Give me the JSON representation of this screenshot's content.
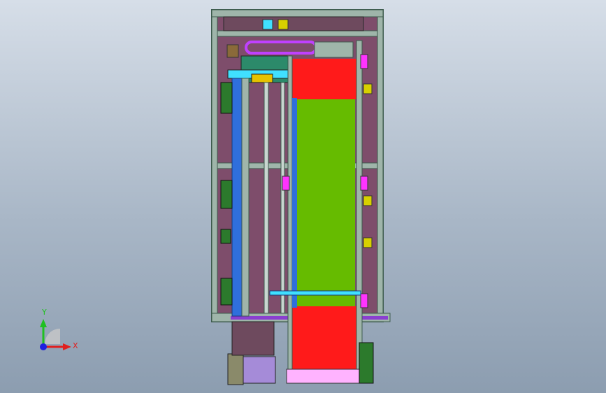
{
  "viewport": {
    "background_top": "#d6dee8",
    "background_bottom": "#8c9db0"
  },
  "colors": {
    "frame": "#9fb5aa",
    "frame_dark": "#3c5a4c",
    "panel_purple": "#7e4d6b",
    "belt_red": "#ff1a1a",
    "belt_green": "#66bb00",
    "rail_blue": "#2f6fdc",
    "rail_cyan": "#40e0ff",
    "accent_yellow": "#d8d000",
    "accent_magenta": "#ff33ff",
    "motor_lilac": "#a58bd8",
    "tray_pink": "#ffb3ff",
    "bracket_green": "#2c7a2c",
    "axis_x": "#e02020",
    "axis_y": "#20c020",
    "axis_z": "#2020e0"
  },
  "triad": {
    "x_label": "X",
    "y_label": "Y",
    "icon": "coordinate-triad-icon"
  }
}
